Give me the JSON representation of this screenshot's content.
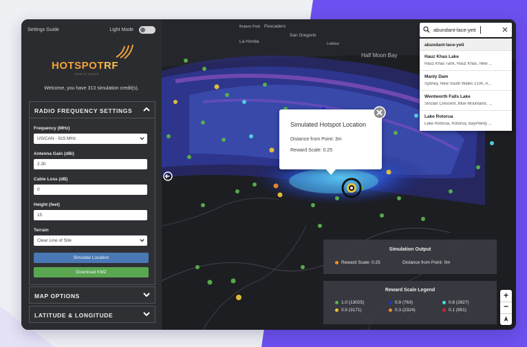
{
  "colors": {
    "accent_blue": "#4a78b5",
    "accent_green": "#5aa651",
    "logo_orange": "#f2a43a",
    "bg_purple": "#6d50f0"
  },
  "sidebar": {
    "settings_guide": "Settings Guide",
    "light_mode_label": "Light Mode",
    "logo_text": "HOTSPOT",
    "logo_rf": "RF",
    "logo_sub": "RADIO MAPS",
    "welcome": "Welcome, you have 313 simulation credit(s).",
    "rf_settings": {
      "title": "RADIO FREQUENCY SETTINGS",
      "frequency_label": "Frequency (MHz)",
      "frequency_value": "US/CAN - 915 MHz",
      "gain_label": "Antenna Gain (dBi)",
      "gain_value": "2.30",
      "cable_label": "Cable Loss (dB)",
      "cable_value": "0",
      "height_label": "Height (feet)",
      "height_value": "15",
      "terrain_label": "Terrain",
      "terrain_value": "Clear Line of Site",
      "simulate_button": "Simulate Location",
      "download_button": "Download KMZ"
    },
    "map_options_title": "MAP OPTIONS",
    "lat_long_title": "LATITUDE & LONGITUDE"
  },
  "map": {
    "place_labels": [
      "Butano Park",
      "Pescadero",
      "San Gregorio",
      "La Honda",
      "Lobitos",
      "Half Moon Bay"
    ],
    "popup": {
      "title": "Simulated Hotspot Location",
      "distance": "Distance from Point: 3m",
      "reward": "Reward Scale: 0.25"
    },
    "search": {
      "value": "abundant-lace-yeti"
    },
    "results": [
      {
        "name": "abundant-lace-yeti",
        "address": ""
      },
      {
        "name": "Hauz Khas Lake",
        "address": "Hauz Khas Tank, Hauz Khas, New ..."
      },
      {
        "name": "Manly Dam",
        "address": "Sydney, New South Wales 2100, A..."
      },
      {
        "name": "Wentworth Falls Lake",
        "address": "Sinclair Crescent, Blue Mountains, ..."
      },
      {
        "name": "Lake Rotorua",
        "address": "Lake Rotorua, Rotorua, BayPlenty ..."
      }
    ],
    "sim_output": {
      "title": "Simulation Output",
      "reward": "Reward Scale: 0.25",
      "distance": "Distance from Point: 0m"
    },
    "legend": {
      "title": "Reward Scale Legend",
      "items": [
        {
          "label": "1.0 (13025)",
          "color": "#59b34a"
        },
        {
          "label": "0.9 (763)",
          "color": "#2437c8"
        },
        {
          "label": "0.8 (2827)",
          "color": "#4fd6e6"
        },
        {
          "label": "0.5 (3171)",
          "color": "#e8c23a"
        },
        {
          "label": "0.3 (2324)",
          "color": "#ee8a25"
        },
        {
          "label": "0.1 (951)",
          "color": "#c7282a"
        }
      ]
    },
    "zoom_in": "+",
    "zoom_out": "−"
  }
}
